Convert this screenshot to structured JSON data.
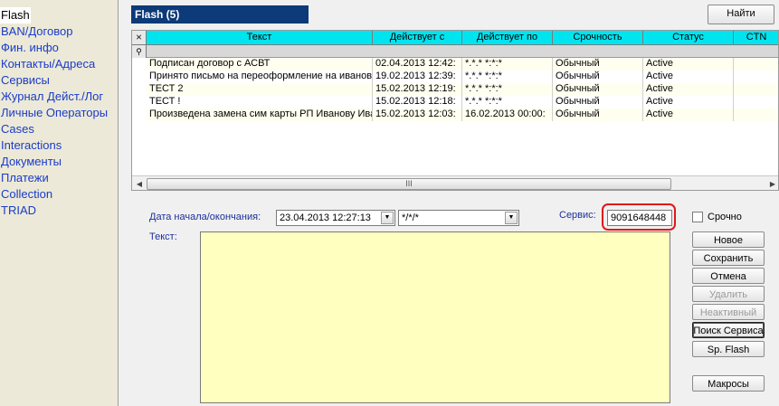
{
  "sidebar": {
    "items": [
      {
        "label": "Flash"
      },
      {
        "label": "BAN/Договор"
      },
      {
        "label": "Фин. инфо"
      },
      {
        "label": "Контакты/Адреса"
      },
      {
        "label": "Сервисы"
      },
      {
        "label": "Журнал Дейст./Лог"
      },
      {
        "label": "Личные Операторы"
      },
      {
        "label": "Cases"
      },
      {
        "label": "Interactions"
      },
      {
        "label": "Документы"
      },
      {
        "label": "Платежи"
      },
      {
        "label": "Collection"
      },
      {
        "label": "TRIAD"
      }
    ]
  },
  "header": {
    "title": "Flash (5)",
    "find_label": "Найти"
  },
  "grid": {
    "columns": [
      "Текст",
      "Действует с",
      "Действует по",
      "Срочность",
      "Статус",
      "CTN"
    ],
    "rows": [
      [
        "Подписан договор с АСВТ",
        "02.04.2013 12:42:",
        "*.*.* *:*:*",
        "Обычный",
        "Active",
        ""
      ],
      [
        "Принято письмо на переоформление на иванов",
        "19.02.2013 12:39:",
        "*.*.* *:*:*",
        "Обычный",
        "Active",
        ""
      ],
      [
        "ТЕСТ 2",
        "15.02.2013 12:19:",
        "*.*.* *:*:*",
        "Обычный",
        "Active",
        ""
      ],
      [
        "ТЕСТ !",
        "15.02.2013 12:18:",
        "*.*.* *:*:*",
        "Обычный",
        "Active",
        ""
      ],
      [
        "Произведена замена сим карты РП Иванову Ива",
        "15.02.2013 12:03:",
        "16.02.2013 00:00:",
        "Обычный",
        "Active",
        ""
      ]
    ],
    "scroll_thumb_label": "III"
  },
  "form": {
    "date_label": "Дата начала/окончания:",
    "date_start": "23.04.2013 12:27:13",
    "date_end": "*/*/*",
    "service_label": "Сервис:",
    "service_value": "9091648448",
    "urgent_label": "Срочно",
    "text_label": "Текст:"
  },
  "buttons": {
    "new": "Новое",
    "save": "Сохранить",
    "cancel": "Отмена",
    "delete": "Удалить",
    "inactive": "Неактивный",
    "search_service": "Поиск Сервиса",
    "sp_flash": "Sp. Flash",
    "macros": "Макросы"
  },
  "colors": {
    "header_bg": "#0d3a78",
    "grid_header": "#00e4f0",
    "text_area": "#ffffc0",
    "highlight": "#e01818"
  }
}
